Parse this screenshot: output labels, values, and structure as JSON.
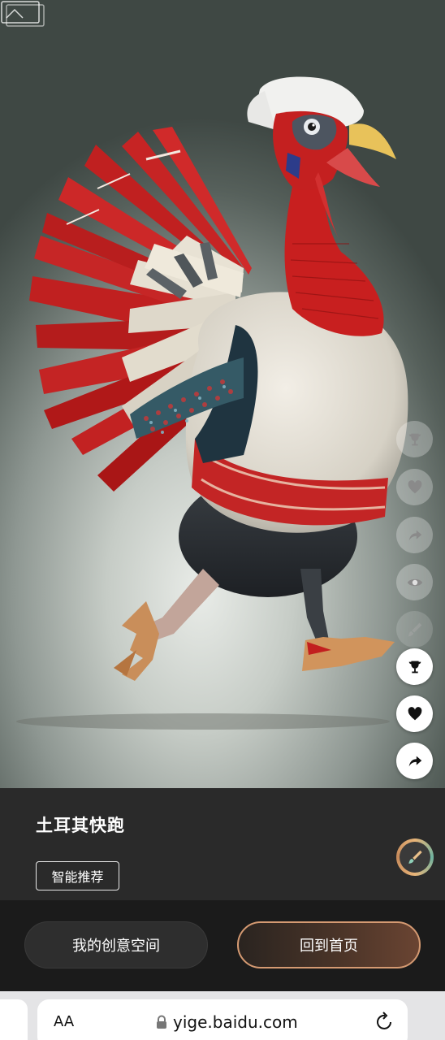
{
  "artwork": {
    "subject": "running turkey illustration",
    "watermark_icon": "image-stack-watermark-icon"
  },
  "info": {
    "title": "土耳其快跑",
    "tag": "智能推荐"
  },
  "side_actions": {
    "faded": [
      "trophy-icon",
      "heart-icon",
      "share-icon",
      "eye-icon",
      "brush-icon"
    ],
    "solid": [
      "trophy-icon",
      "heart-icon",
      "share-icon",
      "eye-icon",
      "brush-icon"
    ]
  },
  "buttons": {
    "my_space": "我的创意空间",
    "home": "回到首页"
  },
  "browser": {
    "text_size": "AA",
    "url": "yige.baidu.com",
    "lock_icon": "lock-icon",
    "reload_icon": "reload-icon"
  },
  "colors": {
    "panel": "#2a2a2a",
    "home_border": "#d59a72",
    "turkey_red": "#c81f1f"
  }
}
